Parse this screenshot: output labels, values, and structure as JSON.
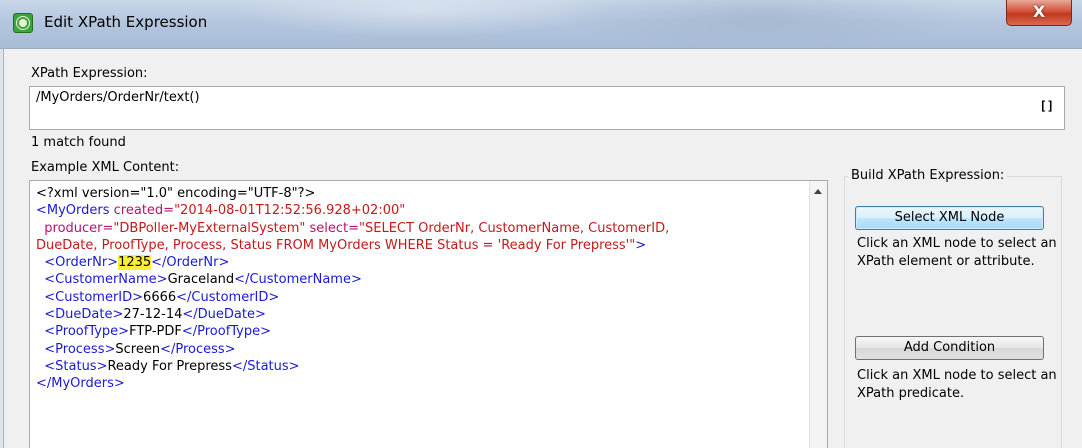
{
  "window": {
    "title": "Edit XPath Expression",
    "close_label": "X",
    "icon": "gear-icon"
  },
  "xpath": {
    "label": "XPath Expression:",
    "value": "/MyOrders/OrderNr/text()",
    "bracket_button": "[]"
  },
  "status": {
    "match_text": "1 match found"
  },
  "example": {
    "label": "Example XML Content:"
  },
  "xml_lines": {
    "l1": "<?xml version=\"1.0\" encoding=\"UTF-8\"?>",
    "l2_tag": "<MyOrders",
    "l2_attr": " created=",
    "l2_val": "\"2014-08-01T12:52:56.928+02:00\"",
    "l3_attr1": "  producer=",
    "l3_val1": "\"DBPoller-MyExternalSystem\"",
    "l3_attr2": " select=",
    "l3_val2": "\"SELECT OrderNr, CustomerName, CustomerID,",
    "l4_val": "DueDate, ProofType, Process, Status FROM MyOrders WHERE Status = 'Ready For Prepress'\"",
    "l4_tag": ">",
    "l5_open": "  <OrderNr>",
    "l5_text": "1235",
    "l5_close": "</OrderNr>",
    "l6_open": "  <CustomerName>",
    "l6_text": "Graceland",
    "l6_close": "</CustomerName>",
    "l7_open": "  <CustomerID>",
    "l7_text": "6666",
    "l7_close": "</CustomerID>",
    "l8_open": "  <DueDate>",
    "l8_text": "27-12-14",
    "l8_close": "</DueDate>",
    "l9_open": "  <ProofType>",
    "l9_text": "FTP-PDF",
    "l9_close": "</ProofType>",
    "l10_open": "  <Process>",
    "l10_text": "Screen",
    "l10_close": "</Process>",
    "l11_open": "  <Status>",
    "l11_text": "Ready For Prepress",
    "l11_close": "</Status>",
    "l12": "</MyOrders>"
  },
  "builder": {
    "group_title": "Build XPath Expression:",
    "select_node_label": "Select XML Node",
    "select_node_help": "Click an XML node to select an XPath element or attribute.",
    "add_condition_label": "Add Condition",
    "add_condition_help": "Click an XML node to select an XPath predicate."
  },
  "colors": {
    "tag": "#1a1ad6",
    "attribute": "#b4146a",
    "attribute_value": "#c41a1a",
    "highlight": "#ffee33",
    "close_button": "#c0391f"
  }
}
